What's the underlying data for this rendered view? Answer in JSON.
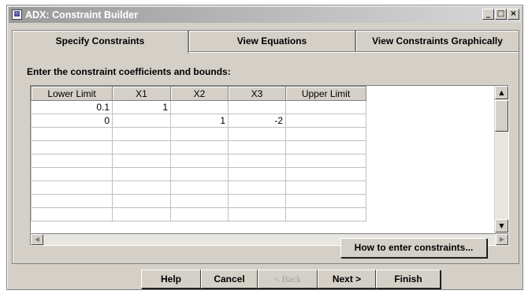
{
  "window": {
    "title": "ADX: Constraint Builder",
    "app_icon": "app-window-icon",
    "minimize": "_",
    "maximize": "□",
    "close": "×"
  },
  "tabs": [
    {
      "label": "Specify Constraints",
      "active": true
    },
    {
      "label": "View Equations",
      "active": false
    },
    {
      "label": "View Constraints Graphically",
      "active": false
    }
  ],
  "panel": {
    "instruction": "Enter the constraint coefficients and bounds:"
  },
  "grid": {
    "columns": [
      "Lower Limit",
      "X1",
      "X2",
      "X3",
      "Upper Limit"
    ],
    "rows": [
      [
        "0.1",
        "1",
        "",
        "",
        ""
      ],
      [
        "0",
        "",
        "1",
        "-2",
        ""
      ],
      [
        "",
        "",
        "",
        "",
        ""
      ],
      [
        "",
        "",
        "",
        "",
        ""
      ],
      [
        "",
        "",
        "",
        "",
        ""
      ],
      [
        "",
        "",
        "",
        "",
        ""
      ],
      [
        "",
        "",
        "",
        "",
        ""
      ],
      [
        "",
        "",
        "",
        "",
        ""
      ],
      [
        "",
        "",
        "",
        "",
        ""
      ]
    ]
  },
  "how_to_button": "How to enter constraints...",
  "buttons": {
    "help": "Help",
    "cancel": "Cancel",
    "back": "< Back",
    "next": "Next >",
    "finish": "Finish"
  }
}
